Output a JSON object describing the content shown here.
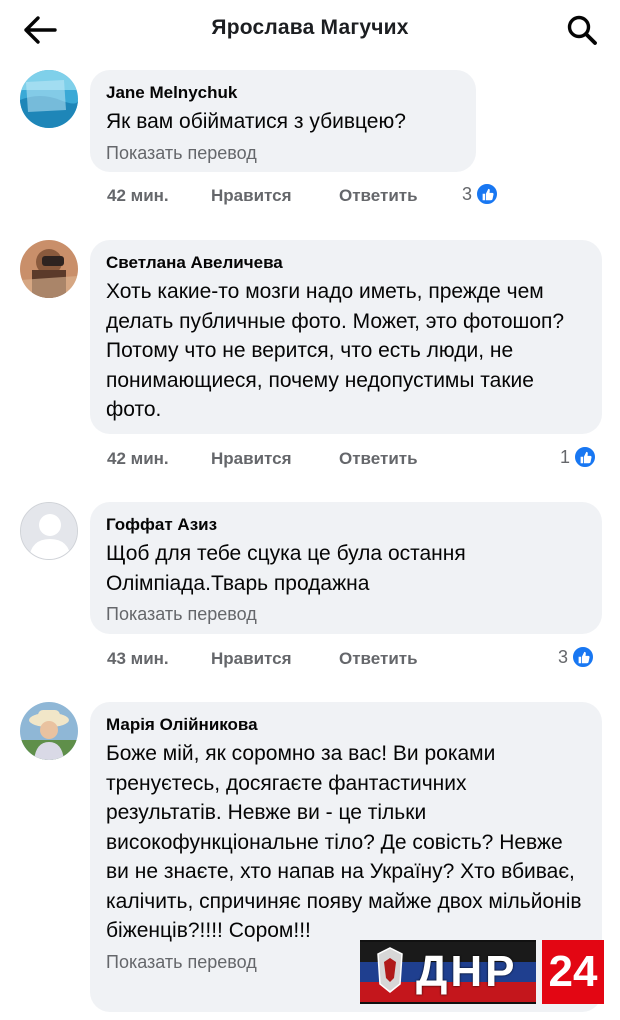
{
  "header": {
    "title": "Ярослава Магучих"
  },
  "comments": [
    {
      "author": "Jane Melnychuk",
      "text": "Як вам обійматися з убивцею?",
      "translate": "Показать перевод",
      "time": "42 мин.",
      "like_label": "Нравится",
      "reply_label": "Ответить",
      "reactions": "3"
    },
    {
      "author": "Светлана Авеличева",
      "text": "Хоть какие-то мозги надо иметь, прежде чем делать публичные фото. Может, это фотошоп? Потому что не верится, что есть люди, не понимающиеся, почему недопустимы такие фото.",
      "time": "42 мин.",
      "like_label": "Нравится",
      "reply_label": "Ответить",
      "reactions": "1"
    },
    {
      "author": "Гоффат Азиз",
      "text": "Щоб для тебе сцука це була остання Олімпіада.Тварь продажна",
      "translate": "Показать перевод",
      "time": "43 мин.",
      "like_label": "Нравится",
      "reply_label": "Ответить",
      "reactions": "3"
    },
    {
      "author": "Марія Олійникова",
      "text": "Боже мій, як соромно за вас! Ви роками тренуєтесь, досягаєте фантастичних результатів. Невже ви - це тільки високофункціональне тіло? Де совість? Невже ви не знаєте, хто напав на Україну? Хто вбиває, калічить, спричиняє появу майже двох мільйонів біженців?!!!! Сором!!!",
      "translate": "Показать перевод"
    }
  ],
  "watermark": {
    "text": "ДНР",
    "number": "24"
  },
  "colors": {
    "bubble": "#f0f2f5",
    "meta_text": "#65676b",
    "like_blue": "#1877f2",
    "watermark_red": "#e30613"
  }
}
